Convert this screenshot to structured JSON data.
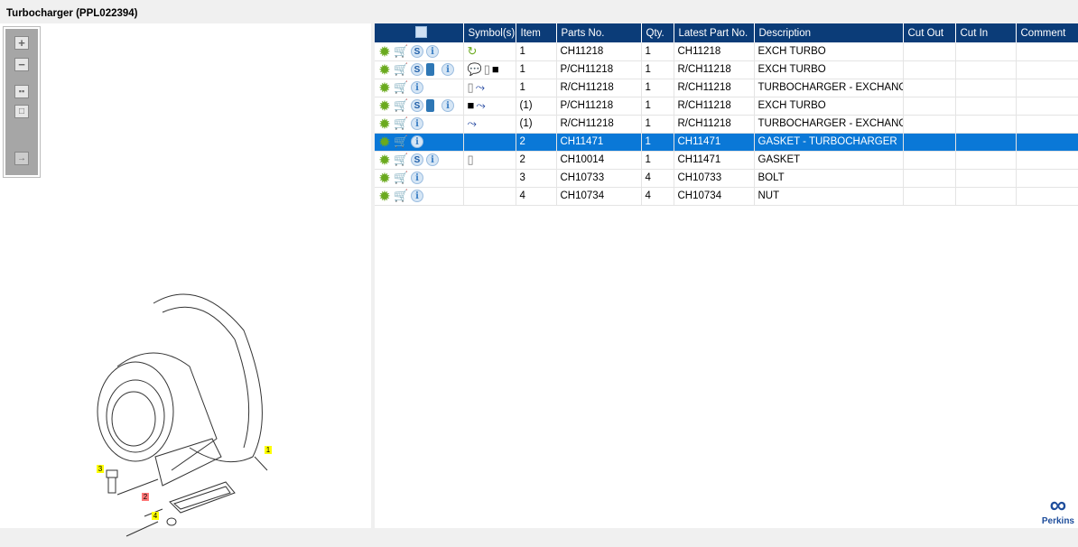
{
  "title": "Turbocharger (PPL022394)",
  "toolbar": {
    "zoom_in": "+",
    "zoom_out": "−"
  },
  "columns": [
    "",
    "Symbol(s)",
    "Item",
    "Parts No.",
    "Qty.",
    "Latest Part No.",
    "Description",
    "Cut Out",
    "Cut In",
    "Comment"
  ],
  "rows": [
    {
      "s": true,
      "book": false,
      "symbols": [
        "rotate-icon"
      ],
      "item": "1",
      "part": "CH11218",
      "qty": "1",
      "latest": "CH11218",
      "desc": "EXCH TURBO"
    },
    {
      "s": true,
      "book": true,
      "symbols": [
        "alert-bubble-icon",
        "catalog-icon",
        "page-link-icon"
      ],
      "item": "1",
      "part": "P/CH11218",
      "qty": "1",
      "latest": "R/CH11218",
      "desc": "EXCH TURBO"
    },
    {
      "s": false,
      "book": false,
      "symbols": [
        "catalog-icon",
        "branch-icon"
      ],
      "item": "1",
      "part": "R/CH11218",
      "qty": "1",
      "latest": "R/CH11218",
      "desc": "TURBOCHARGER - EXCHANGE"
    },
    {
      "s": true,
      "book": true,
      "symbols": [
        "page-link-icon",
        "branch-icon"
      ],
      "item": "(1)",
      "part": "P/CH11218",
      "qty": "1",
      "latest": "R/CH11218",
      "desc": "EXCH TURBO"
    },
    {
      "s": false,
      "book": false,
      "symbols": [
        "branch-icon"
      ],
      "item": "(1)",
      "part": "R/CH11218",
      "qty": "1",
      "latest": "R/CH11218",
      "desc": "TURBOCHARGER - EXCHANGE"
    },
    {
      "s": false,
      "book": false,
      "symbols": [],
      "item": "2",
      "part": "CH11471",
      "qty": "1",
      "latest": "CH11471",
      "desc": "GASKET - TURBOCHARGER",
      "selected": true
    },
    {
      "s": true,
      "book": false,
      "symbols": [
        "catalog-icon"
      ],
      "item": "2",
      "part": "CH10014",
      "qty": "1",
      "latest": "CH11471",
      "desc": "GASKET"
    },
    {
      "s": false,
      "book": false,
      "symbols": [],
      "item": "3",
      "part": "CH10733",
      "qty": "4",
      "latest": "CH10733",
      "desc": "BOLT"
    },
    {
      "s": false,
      "book": false,
      "symbols": [],
      "item": "4",
      "part": "CH10734",
      "qty": "4",
      "latest": "CH10734",
      "desc": "NUT"
    }
  ],
  "callouts": [
    "1",
    "2",
    "3",
    "4"
  ],
  "logo": "Perkins",
  "colors": {
    "header": "#0b3c78",
    "selected": "#0a78d7"
  }
}
